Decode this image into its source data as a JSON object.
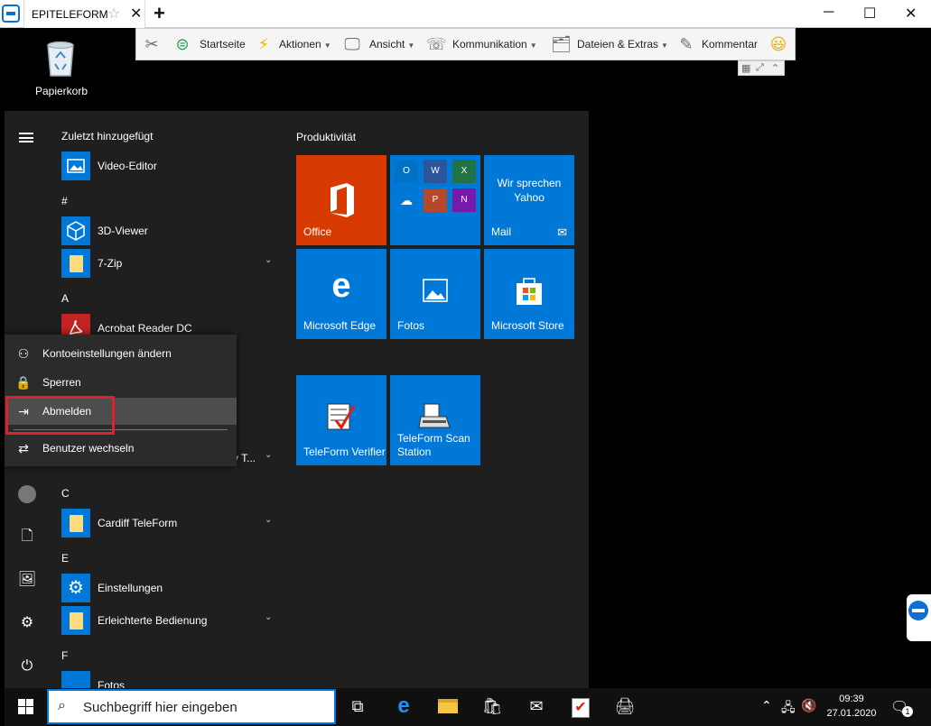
{
  "titlebar": {
    "tab_title": "EPITELEFORM",
    "star_icon": "☆",
    "close_tab_icon": "✕",
    "add_tab_icon": "+",
    "minimize_icon": "─",
    "maximize_icon": "☐",
    "close_icon": "✕"
  },
  "toolbar": {
    "items": [
      {
        "label": "Startseite"
      },
      {
        "label": "Aktionen"
      },
      {
        "label": "Ansicht"
      },
      {
        "label": "Kommunikation"
      },
      {
        "label": "Dateien & Extras"
      },
      {
        "label": "Kommentar"
      }
    ],
    "smiley": "😃"
  },
  "desktop": {
    "recycle_label": "Papierkorb"
  },
  "startmenu": {
    "recent_header": "Zuletzt hinzugefügt",
    "apps": [
      {
        "letter": "",
        "name": "Video-Editor"
      },
      {
        "letter": "#",
        "name": "3D-Viewer"
      },
      {
        "letter": "",
        "name": "7-Zip"
      },
      {
        "letter": "A",
        "name": "Acrobat Reader DC"
      },
      {
        "letter": "",
        "name": "y T..."
      },
      {
        "letter": "C",
        "name": "Cardiff TeleForm"
      },
      {
        "letter": "E",
        "name": "Einstellungen"
      },
      {
        "letter": "",
        "name": "Erleichterte Bedienung"
      },
      {
        "letter": "F",
        "name": "Fotos"
      }
    ],
    "tiles_group": "Produktivität",
    "tiles": {
      "office": "Office",
      "mail_top": "Wir sprechen Yahoo",
      "mail": "Mail",
      "edge": "Microsoft Edge",
      "fotos": "Fotos",
      "store": "Microsoft Store",
      "tf_verifier": "TeleForm Verifier",
      "tf_scan": "TeleForm Scan Station"
    }
  },
  "account_menu": {
    "change_settings": "Kontoeinstellungen ändern",
    "lock": "Sperren",
    "sign_out": "Abmelden",
    "switch_user": "Benutzer wechseln"
  },
  "taskbar": {
    "search_placeholder": "Suchbegriff hier eingeben",
    "time": "09:39",
    "date": "27.01.2020",
    "notification_count": "1"
  }
}
